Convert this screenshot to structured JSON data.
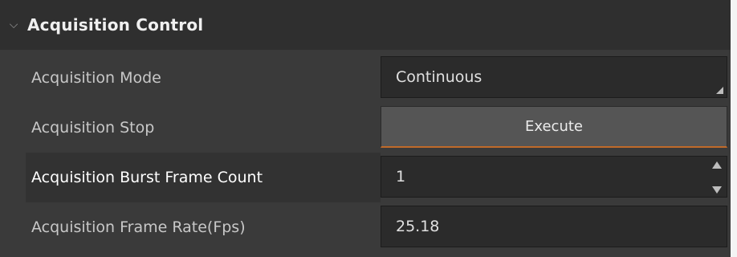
{
  "group": {
    "title": "Acquisition Control",
    "expand_icon": "chevron-down-icon"
  },
  "rows": [
    {
      "label": "Acquisition Mode",
      "value": "Continuous",
      "control": "combobox"
    },
    {
      "label": "Acquisition Stop",
      "value": "Execute",
      "control": "button"
    },
    {
      "label": "Acquisition Burst Frame Count",
      "value": "1",
      "control": "spinbox"
    },
    {
      "label": "Acquisition Frame Rate(Fps)",
      "value": "25.18",
      "control": "text"
    }
  ],
  "colors": {
    "panel_bg": "#3a3a3a",
    "header_bg": "#2f2f2f",
    "field_bg": "#2b2b2b",
    "button_bg": "#555555",
    "button_accent": "#c06a2a"
  }
}
